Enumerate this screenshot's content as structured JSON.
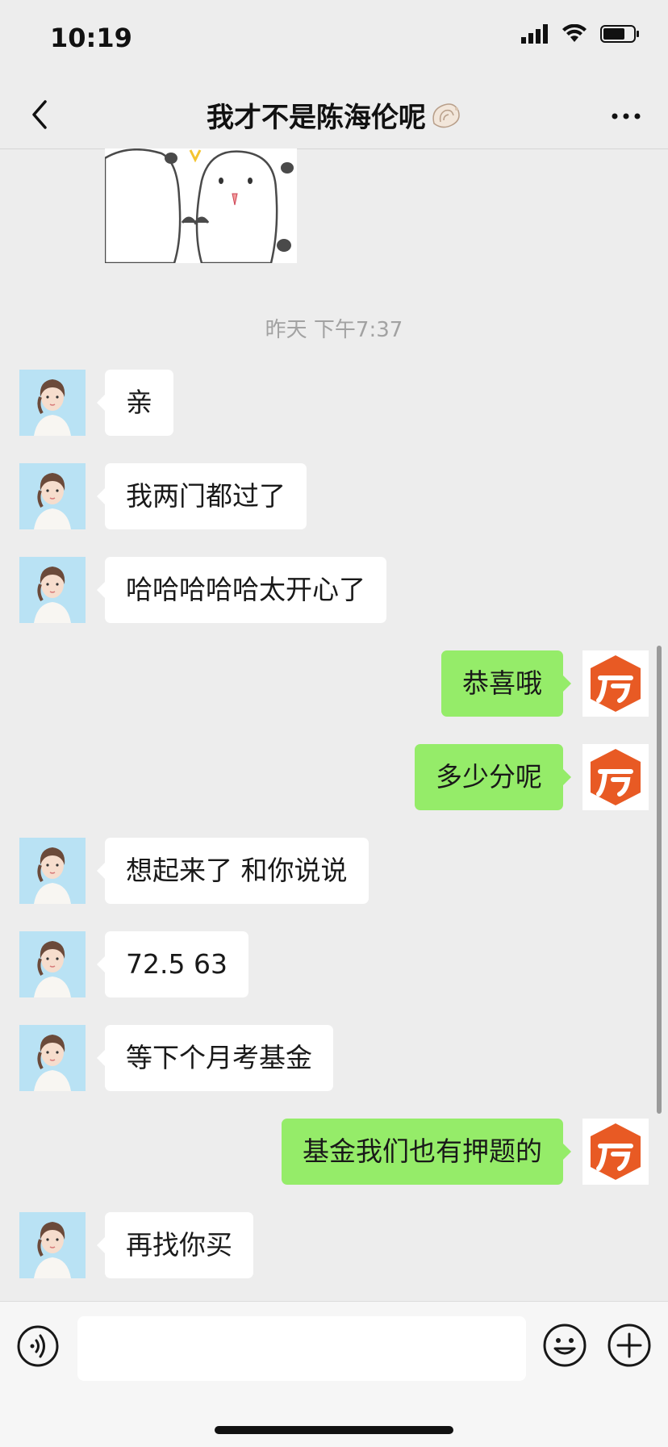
{
  "status_bar": {
    "time": "10:19",
    "icons": [
      "cellular-signal-icon",
      "wifi-icon",
      "battery-icon"
    ]
  },
  "header": {
    "title": "我才不是陈海伦呢",
    "title_emoji": "shell-emoji-icon",
    "back_icon": "chevron-left-icon",
    "more_icon": "more-dots-icon"
  },
  "timestamp": "昨天 下午7:37",
  "messages": [
    {
      "side": "left",
      "text": "亲"
    },
    {
      "side": "left",
      "text": "我两门都过了"
    },
    {
      "side": "left",
      "text": "哈哈哈哈哈太开心了"
    },
    {
      "side": "right",
      "text": "恭喜哦"
    },
    {
      "side": "right",
      "text": "多少分呢"
    },
    {
      "side": "left",
      "text": "想起来了 和你说说"
    },
    {
      "side": "left",
      "text": "72.5 63"
    },
    {
      "side": "left",
      "text": "等下个月考基金"
    },
    {
      "side": "right",
      "text": "基金我们也有押题的"
    },
    {
      "side": "left",
      "text": "再找你买"
    }
  ],
  "input_bar": {
    "voice_icon": "voice-icon",
    "emoji_icon": "emoji-icon",
    "plus_icon": "plus-icon",
    "input_value": ""
  },
  "colors": {
    "background": "#ededed",
    "outgoing_bubble": "#95ec69",
    "incoming_bubble": "#ffffff",
    "brand_orange": "#e85a24"
  }
}
